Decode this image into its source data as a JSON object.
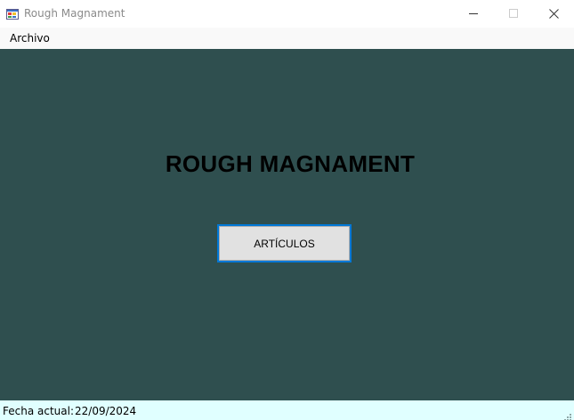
{
  "window": {
    "title": "Rough Magnament",
    "icon": "winforms-app-icon"
  },
  "menubar": {
    "items": [
      {
        "label": "Archivo"
      }
    ]
  },
  "main": {
    "heading": "ROUGH MAGNAMENT",
    "button_label": "ARTÍCULOS",
    "background_color": "#2f4f4f"
  },
  "statusbar": {
    "date_label": "Fecha actual:",
    "date_value": "22/09/2024",
    "background_color": "#e0ffff"
  },
  "colors": {
    "accent": "#0078d7"
  }
}
